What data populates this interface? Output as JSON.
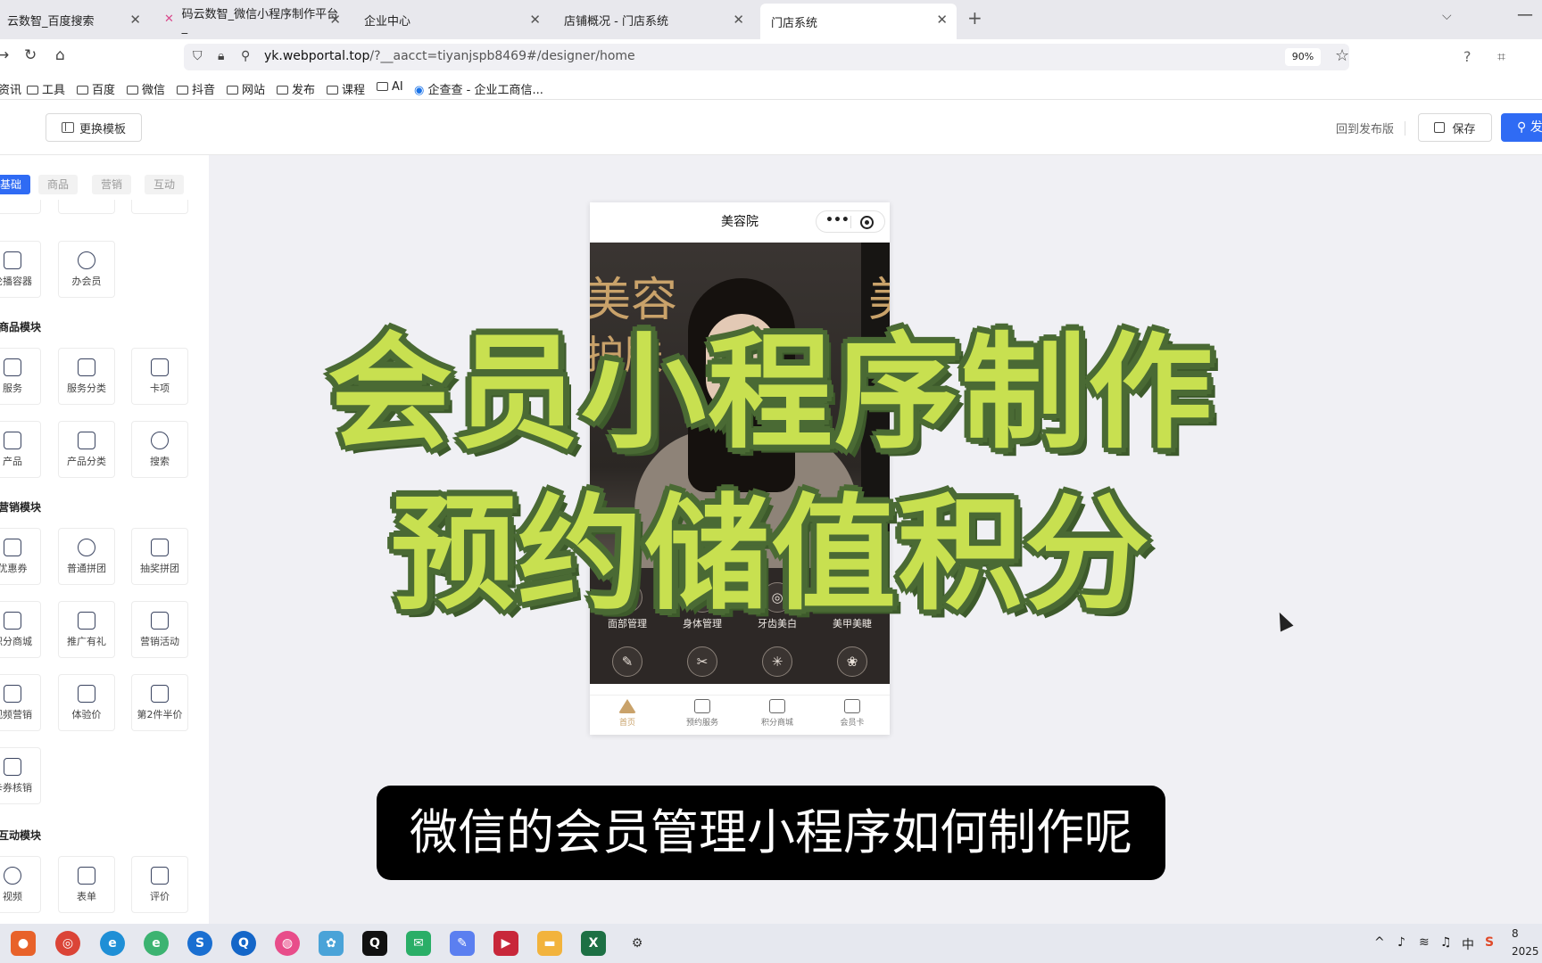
{
  "browser": {
    "tabs": [
      {
        "label": "云数智_百度搜索",
        "active": false
      },
      {
        "label": "码云数智_微信小程序制作平台_",
        "active": false
      },
      {
        "label": "企业中心",
        "active": false
      },
      {
        "label": "店铺概况 - 门店系统",
        "active": false
      },
      {
        "label": "门店系统",
        "active": true
      }
    ],
    "new_tab": "+",
    "url_host": "yk.webportal.top",
    "url_path": "/?__aacct=tiyanjspb8469#/designer/home",
    "zoom": "90%",
    "bookmarks": [
      "资讯",
      "工具",
      "百度",
      "微信",
      "抖音",
      "网站",
      "发布",
      "课程",
      "AI",
      "企查查 - 企业工商信..."
    ]
  },
  "header": {
    "change_template": "更换模板",
    "back_to_published": "回到发布版",
    "save": "保存",
    "publish": "发"
  },
  "sidebar": {
    "tabs": [
      {
        "label": "基础",
        "active": true
      },
      {
        "label": "商品",
        "active": false
      },
      {
        "label": "营销",
        "active": false
      },
      {
        "label": "互动",
        "active": false
      }
    ],
    "top_tiles": [
      "轮播容器",
      "办会员"
    ],
    "goods_title": "商品模块",
    "goods_tiles": [
      "服务",
      "服务分类",
      "卡项",
      "产品",
      "产品分类",
      "搜索"
    ],
    "marketing_title": "营销模块",
    "marketing_tiles": [
      "优惠券",
      "普通拼团",
      "抽奖拼团",
      "积分商城",
      "推广有礼",
      "营销活动",
      "视频营销",
      "体验价",
      "第2件半价",
      "卡券核销"
    ],
    "interactive_title": "互动模块",
    "interactive_tiles": [
      "视频",
      "表单",
      "评价"
    ]
  },
  "phone": {
    "title": "美容院",
    "capsule_dots": "•••",
    "banner_text_1": "美容",
    "banner_text_2": "护肤",
    "banner_text_right": "美",
    "categories": [
      "面部管理",
      "身体管理",
      "牙齿美白",
      "美甲美睫"
    ],
    "tabbar": [
      {
        "label": "首页",
        "active": true
      },
      {
        "label": "预约服务",
        "active": false
      },
      {
        "label": "积分商城",
        "active": false
      },
      {
        "label": "会员卡",
        "active": false
      }
    ]
  },
  "overlay": {
    "headline_1": "会员小程序制作",
    "headline_2": "预约储值积分",
    "subtitle": "微信的会员管理小程序如何制作呢"
  },
  "taskbar": {
    "tray_lang": "中",
    "clock_partial_1": "8",
    "clock_partial_2": "2025"
  },
  "colors": {
    "accent_blue": "#2f6bf4",
    "headline_fill": "#c8e050",
    "headline_stroke": "#4a6a34",
    "gold": "#c9a26a"
  }
}
